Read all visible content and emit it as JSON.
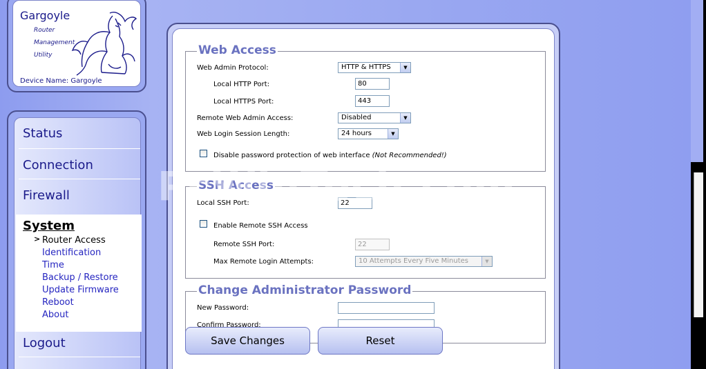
{
  "logo": {
    "title": "Gargoyle",
    "sub1": "Router",
    "sub2": "Management",
    "sub3": "Utility",
    "device_name": "Device Name: Gargoyle"
  },
  "nav": {
    "status": "Status",
    "connection": "Connection",
    "firewall": "Firewall",
    "system": "System",
    "arrow": ">",
    "sub": [
      "Router Access",
      "Identification",
      "Time",
      "Backup / Restore",
      "Update Firmware",
      "Reboot",
      "About"
    ],
    "logout": "Logout"
  },
  "web_access": {
    "legend": "Web Access",
    "protocol_label": "Web Admin Protocol:",
    "protocol_value": "HTTP & HTTPS",
    "http_port_label": "Local HTTP Port:",
    "http_port_value": "80",
    "https_port_label": "Local HTTPS Port:",
    "https_port_value": "443",
    "remote_label": "Remote Web Admin Access:",
    "remote_value": "Disabled",
    "session_label": "Web Login Session Length:",
    "session_value": "24 hours",
    "disable_pw_label": "Disable password protection of web interface",
    "disable_pw_note": "(Not Recommended!)"
  },
  "ssh_access": {
    "legend": "SSH Access",
    "local_port_label": "Local SSH Port:",
    "local_port_value": "22",
    "enable_remote_label": "Enable Remote SSH Access",
    "remote_port_label": "Remote SSH Port:",
    "remote_port_value": "22",
    "max_attempts_label": "Max Remote Login Attempts:",
    "max_attempts_value": "10 Attempts Every Five Minutes"
  },
  "password": {
    "legend": "Change Administrator Password",
    "new_label": "New Password:",
    "confirm_label": "Confirm Password:"
  },
  "buttons": {
    "save": "Save Changes",
    "reset": "Reset"
  },
  "watermark": "PcWinTech.com",
  "colors": {
    "background": "#8f9ef0",
    "legend": "#6a72c0",
    "link": "#2525c0",
    "nav_text": "#1a1a8a"
  }
}
